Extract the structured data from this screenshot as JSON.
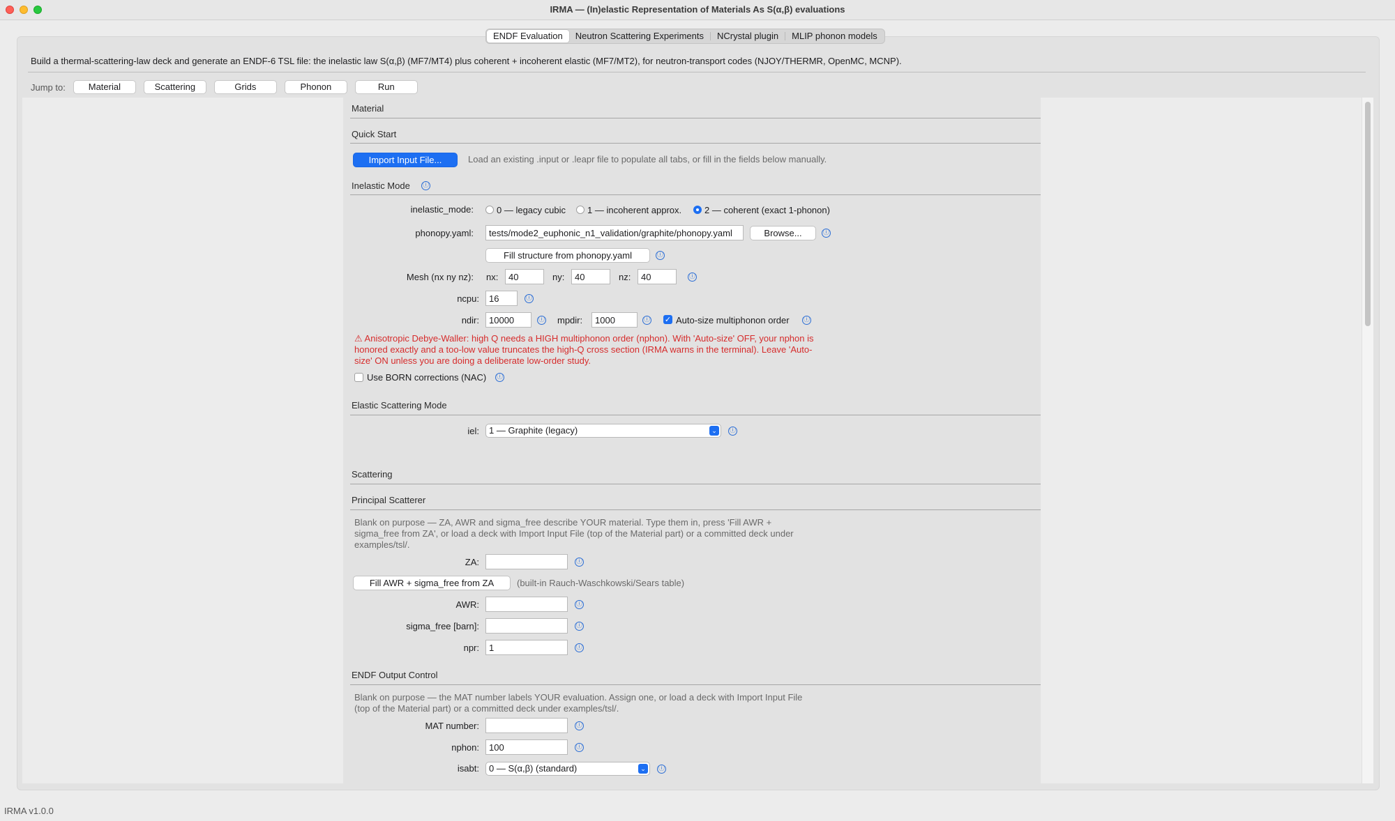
{
  "window": {
    "title": "IRMA — (In)elastic Representation of Materials As S(α,β) evaluations"
  },
  "tabs": [
    {
      "label": "ENDF Evaluation",
      "active": true
    },
    {
      "label": "Neutron Scattering Experiments",
      "active": false
    },
    {
      "label": "NCrystal plugin",
      "active": false
    },
    {
      "label": "MLIP phonon models",
      "active": false
    }
  ],
  "description": "Build a thermal-scattering-law deck and generate an ENDF-6 TSL file: the inelastic law S(α,β) (MF7/MT4) plus coherent + incoherent elastic (MF7/MT2), for neutron-transport codes (NJOY/THERMR, OpenMC, MCNP).",
  "jump": {
    "label": "Jump to:",
    "buttons": [
      "Material",
      "Scattering",
      "Grids",
      "Phonon",
      "Run"
    ]
  },
  "icons": {
    "info": "ⓘ",
    "chevron": "⌄",
    "check": "✓",
    "warning": "⚠"
  },
  "material": {
    "title": "Material",
    "quick_start": {
      "title": "Quick Start",
      "import_button": "Import Input File...",
      "hint": "Load an existing .input or .leapr file to populate all tabs, or fill in the fields below manually."
    },
    "inelastic": {
      "title": "Inelastic Mode",
      "mode_label": "inelastic_mode:",
      "options": [
        {
          "label": "0 — legacy cubic",
          "selected": false
        },
        {
          "label": "1 — incoherent approx.",
          "selected": false
        },
        {
          "label": "2 — coherent (exact 1-phonon)",
          "selected": true
        }
      ],
      "phonopy_label": "phonopy.yaml:",
      "phonopy_value": "tests/mode2_euphonic_n1_validation/graphite/phonopy.yaml",
      "browse_button": "Browse...",
      "fill_structure_button": "Fill structure from phonopy.yaml",
      "mesh_label": "Mesh (nx ny nz):",
      "nx_label": "nx:",
      "nx_value": "40",
      "ny_label": "ny:",
      "ny_value": "40",
      "nz_label": "nz:",
      "nz_value": "40",
      "ncpu_label": "ncpu:",
      "ncpu_value": "16",
      "ndir_label": "ndir:",
      "ndir_value": "10000",
      "mpdir_label": "mpdir:",
      "mpdir_value": "1000",
      "autosize_label": "Auto-size multiphonon order",
      "autosize_checked": true,
      "warning": "⚠ Anisotropic Debye-Waller: high Q needs a HIGH multiphonon order (nphon). With 'Auto-size' OFF, your nphon is honored exactly and a too-low value truncates the high-Q cross section (IRMA warns in the terminal). Leave 'Auto-size' ON unless you are doing a deliberate low-order study.",
      "born_label": "Use BORN corrections (NAC)",
      "born_checked": false
    },
    "elastic": {
      "title": "Elastic Scattering Mode",
      "iel_label": "iel:",
      "iel_value": "1 — Graphite (legacy)"
    }
  },
  "scattering": {
    "title": "Scattering",
    "principal": {
      "title": "Principal Scatterer",
      "note": "Blank on purpose — ZA, AWR and sigma_free describe YOUR material. Type them in, press 'Fill AWR + sigma_free from ZA', or load a deck with Import Input File (top of the Material part) or a committed deck under examples/tsl/.",
      "za_label": "ZA:",
      "za_value": "",
      "fill_button": "Fill AWR + sigma_free from ZA",
      "fill_hint": "(built-in Rauch-Waschkowski/Sears table)",
      "awr_label": "AWR:",
      "awr_value": "",
      "sigma_label": "sigma_free [barn]:",
      "sigma_value": "",
      "npr_label": "npr:",
      "npr_value": "1"
    },
    "endf": {
      "title": "ENDF Output Control",
      "note": "Blank on purpose — the MAT number labels YOUR evaluation. Assign one, or load a deck with Import Input File (top of the Material part) or a committed deck under examples/tsl/.",
      "mat_label": "MAT number:",
      "mat_value": "",
      "nphon_label": "nphon:",
      "nphon_value": "100",
      "isabt_label": "isabt:",
      "isabt_value": "0 — S(α,β) (standard)"
    }
  },
  "status": "IRMA v1.0.0"
}
